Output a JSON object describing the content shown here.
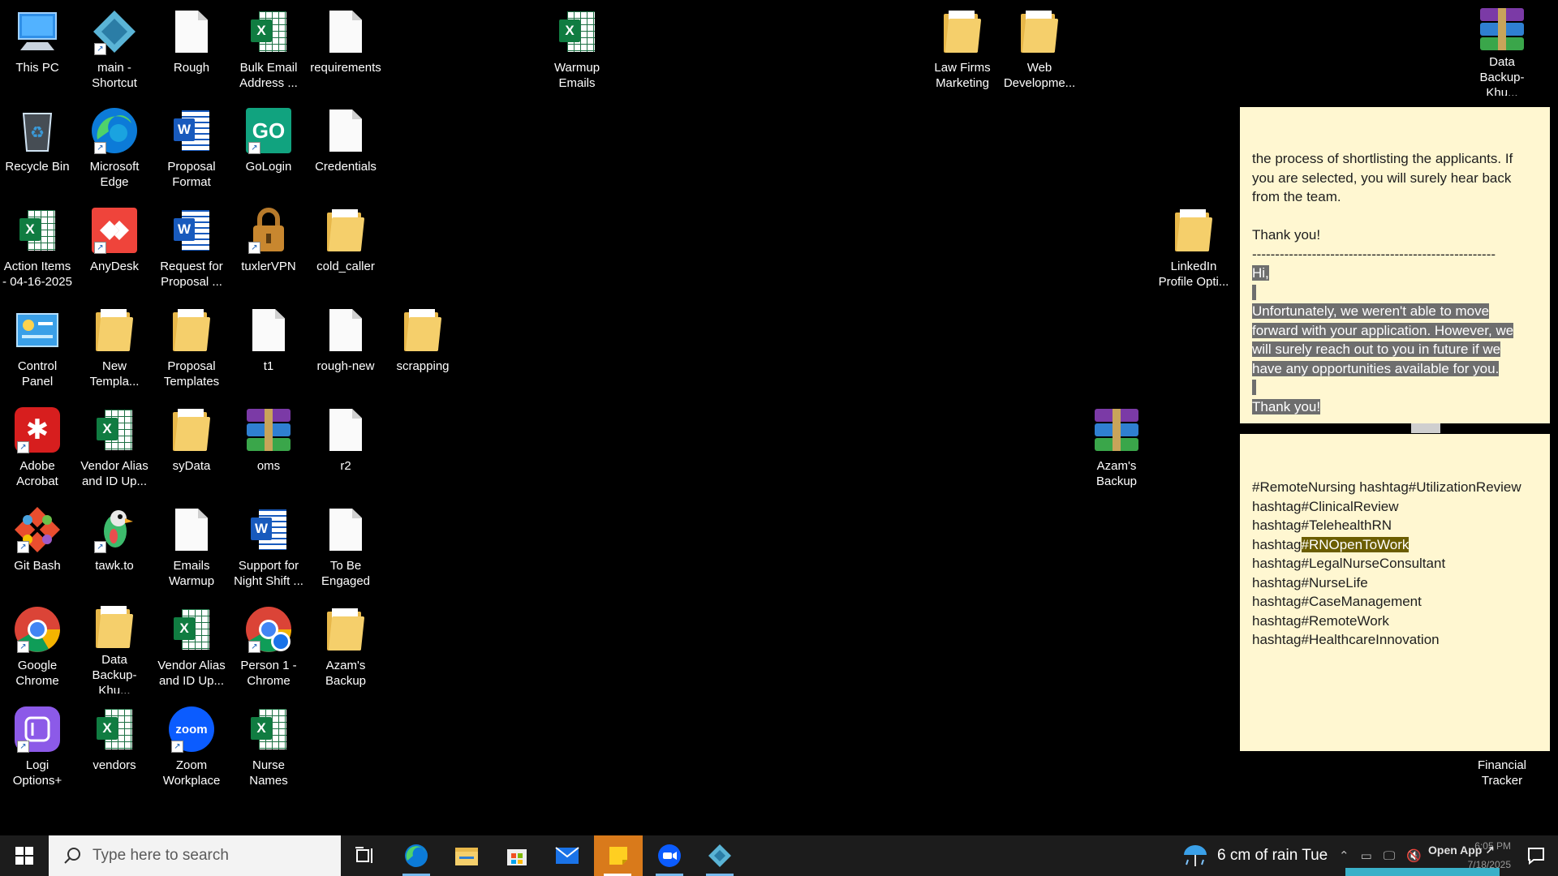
{
  "icons": {
    "this_pc": "This PC",
    "main_shortcut": "main -\nShortcut",
    "rough": "Rough",
    "bulk_email": "Bulk Email\nAddress ...",
    "requirements": "requirements",
    "warmup_emails": "Warmup\nEmails",
    "law_firms": "Law Firms\nMarketing",
    "web_development": "Web\nDevelopme...",
    "data_backup_top": "Data\nBackup-Khu...",
    "recycle_bin": "Recycle Bin",
    "edge": "Microsoft\nEdge",
    "proposal_format": "Proposal\nFormat",
    "gologin": "GoLogin",
    "credentials": "Credentials",
    "action_items": "Action Items\n- 04-16-2025",
    "anydesk": "AnyDesk",
    "request_proposal": "Request for\nProposal ...",
    "tuxler": "tuxlerVPN",
    "cold_caller": "cold_caller",
    "linkedin": "LinkedIn\nProfile Opti...",
    "control_panel": "Control Panel",
    "new_templa": "New\nTempla...",
    "proposal_templates": "Proposal\nTemplates",
    "t1": "t1",
    "rough_new": "rough-new",
    "scrapping": "scrapping",
    "adobe": "Adobe\nAcrobat",
    "vendor_alias_1": "Vendor Alias\nand ID Up...",
    "sydata": "syData",
    "oms": "oms",
    "r2": "r2",
    "azams_backup_right": "Azam's\nBackup",
    "git_bash": "Git Bash",
    "tawk": "tawk.to",
    "emails_warmup": "Emails\nWarmup",
    "support_night": "Support for\nNight Shift ...",
    "to_be_engaged": "To Be\nEngaged",
    "chrome": "Google\nChrome",
    "data_backup_left": "Data\nBackup-Khu...",
    "vendor_alias_2": "Vendor Alias\nand ID Up...",
    "person1_chrome": "Person 1 -\nChrome",
    "azams_backup_left": "Azam's\nBackup",
    "logi": "Logi\nOptions+",
    "vendors": "vendors",
    "zoom": "Zoom\nWorkplace",
    "nurse_names": "Nurse Names",
    "financial_tracker": "Financial\nTracker"
  },
  "note1": {
    "line1": "the process of shortlisting the applicants. If",
    "line2": "you are selected, you will surely hear back",
    "line3": "from the team.",
    "thanks": "Thank you!",
    "divider": "-------------------------------------------------------------",
    "sel_hi": "Hi,",
    "sel_l1": "Unfortunately, we weren't able to move",
    "sel_l2": "forward with your application. However, we",
    "sel_l3": "will surely reach out to you in future if we",
    "sel_l4": "have any opportunities available for you.",
    "sel_thanks": "Thank you!"
  },
  "note2": {
    "l1": "#RemoteNursing hashtag#UtilizationReview",
    "l2": "hashtag#ClinicalReview",
    "l3": "hashtag#TelehealthRN",
    "l4_pre": "hashtag",
    "l4_hl": "#RNOpenToWork",
    "l5": "hashtag#LegalNurseConsultant",
    "l6": "hashtag#NurseLife",
    "l7": "hashtag#CaseManagement",
    "l8": "hashtag#RemoteWork",
    "l9": "hashtag#HealthcareInnovation"
  },
  "taskbar": {
    "search_placeholder": "Type here to search",
    "weather": "6 cm of rain Tue",
    "open_app": "Open App ↗",
    "time": "6:05 PM",
    "date": "7/18/2025"
  },
  "colors": {
    "note_bg": "#fff7d1",
    "excel_green": "#107c41",
    "word_blue": "#185abd",
    "sticky_orange": "#d97a1b"
  }
}
